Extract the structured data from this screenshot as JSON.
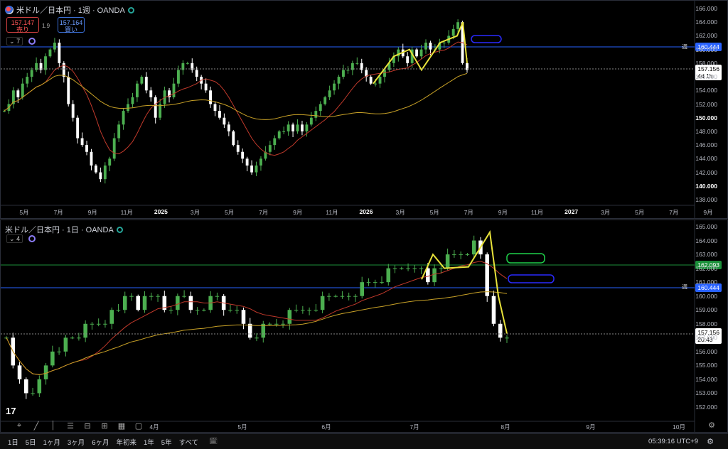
{
  "top": {
    "symbol": "米ドル／日本円 · 1週 · OANDA",
    "sell_price": "157.147",
    "sell_label": "売り",
    "buy_price": "157.164",
    "buy_label": "買い",
    "spread": "1.9",
    "indicator_count": "7",
    "price_ticks": [
      "166.000",
      "164.000",
      "162.000",
      "160.000",
      "158.000",
      "156.000",
      "154.000",
      "152.000",
      "150.000",
      "148.000",
      "146.000",
      "144.000",
      "142.000",
      "140.000",
      "138.000"
    ],
    "bold_ticks": [
      "150.000",
      "140.000"
    ],
    "time_ticks": [
      "5月",
      "7月",
      "9月",
      "11月",
      "2025",
      "3月",
      "5月",
      "7月",
      "9月",
      "11月",
      "2026",
      "3月",
      "5月",
      "7月",
      "9月",
      "11月",
      "2027",
      "3月",
      "5月",
      "7月",
      "9月"
    ],
    "bold_time_ticks": [
      "2025",
      "2026",
      "2027"
    ],
    "hline_label": "160.444",
    "week_tag": "週",
    "last_price": "157.156",
    "countdown": "4d 1h"
  },
  "bottom": {
    "symbol": "米ドル／日本円 · 1日 · OANDA",
    "indicator_count": "4",
    "price_ticks": [
      "165.000",
      "164.000",
      "163.000",
      "162.000",
      "161.000",
      "160.000",
      "159.000",
      "158.000",
      "157.000",
      "156.000",
      "155.000",
      "154.000",
      "153.000",
      "152.000"
    ],
    "time_ticks": [
      "4月",
      "5月",
      "6月",
      "7月",
      "8月",
      "9月",
      "10月"
    ],
    "hline_blue_label": "160.444",
    "hline_green_label": "162.093",
    "week_tag": "週",
    "last_price": "157.156",
    "countdown": "20:43"
  },
  "timeframes": [
    "1日",
    "5日",
    "1ヶ月",
    "3ヶ月",
    "6ヶ月",
    "年初来",
    "1年",
    "5年",
    "すべて"
  ],
  "clock": "05:39:16 UTC+9",
  "icons": [
    "calendar-icon",
    "gear-icon",
    "drawing-tools"
  ],
  "colors": {
    "up": "#4caf50",
    "down": "#ffffff",
    "ma_red": "#c0392b",
    "ma_yellow": "#c9a227",
    "hline_blue": "#2962ff",
    "hline_green": "#1b8f3a"
  }
}
